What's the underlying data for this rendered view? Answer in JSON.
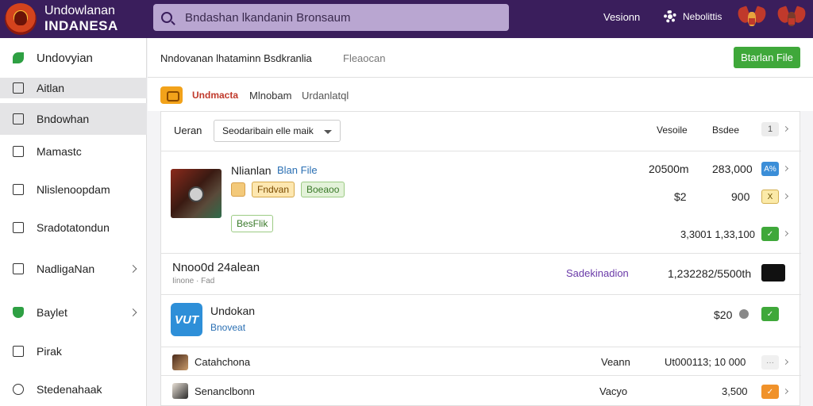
{
  "header": {
    "logo_line1": "Undowlanan",
    "logo_line2": "INDANESA",
    "search_placeholder": "Bndashan lkandanin Bronsaum",
    "link": "Vesionn",
    "settings": "Nebolittis"
  },
  "sidebar": {
    "items": [
      {
        "label": "Undovyian",
        "icon": "leaf-icon"
      },
      {
        "label": "Aitlan",
        "icon": "checkbox-icon"
      },
      {
        "label": "Bndowhan",
        "icon": "document-icon"
      },
      {
        "label": "Mamastc",
        "icon": "calendar-icon"
      },
      {
        "label": "Nlislenoopdam",
        "icon": "grid-icon"
      },
      {
        "label": "Sradotatondun",
        "icon": "edit-icon"
      },
      {
        "label": "NadligaNan",
        "icon": "briefcase-icon"
      },
      {
        "label": "Baylet",
        "icon": "shield-icon"
      },
      {
        "label": "Pirak",
        "icon": "list-icon"
      },
      {
        "label": "Stedenahaak",
        "icon": "info-icon"
      }
    ]
  },
  "page": {
    "breadcrumb": "Nndovanan lhataminn Bsdkranlia",
    "breadcrumb_sub": "Fleaocan",
    "primary_button": "Btarlan File",
    "brand": "Undmacta",
    "tab1": "Mlnobam",
    "tab2": "Urdanlatql"
  },
  "table": {
    "filter_label": "Ueran",
    "filter_value": "Seodaribain elle maik",
    "col_versions": "Vesoile",
    "col_status": "Bsdee",
    "page_num": "1",
    "featured": {
      "title_a": "Nlianlan",
      "title_b": "Blan File",
      "chip1": "Fndvan",
      "chip2": "Boeaoo",
      "tag": "BesFlik",
      "size": "20500m",
      "count": "283,000",
      "price": "$2",
      "qty": "900",
      "total": "3,3001 1,33,100",
      "mini1": "A%",
      "mini2": "X",
      "mini3": "✓"
    },
    "row2": {
      "title": "Nnoo0d 24alean",
      "subtitle": "Iinone  ·  Fad",
      "link": "Sadekinadion",
      "value": "1,232282/5500th"
    },
    "row3": {
      "logo": "VUT",
      "title": "Undokan",
      "subtitle": "Bnoveat",
      "price": "$20"
    },
    "row4": {
      "name": "Catahchona",
      "label": "Veann",
      "value": "Ut000113; 10 000"
    },
    "row5": {
      "name": "Senanclbonn",
      "label": "Vacyo",
      "value": "3,500"
    }
  }
}
